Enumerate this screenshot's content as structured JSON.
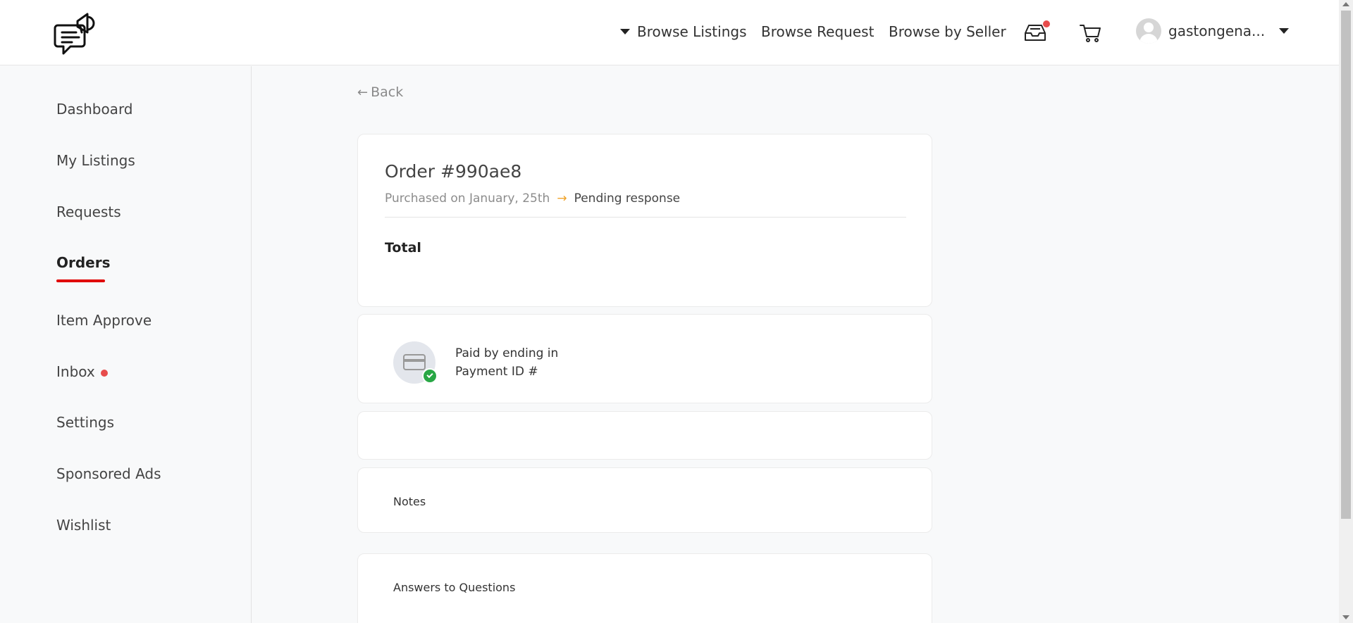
{
  "header": {
    "nav": {
      "browse_listings": "Browse Listings",
      "browse_request": "Browse Request",
      "browse_by_seller": "Browse by Seller"
    },
    "user": {
      "name": "gastongena..."
    },
    "icons": {
      "logo": "chat-megaphone-logo",
      "inbox": "inbox-tray-icon",
      "cart": "shopping-cart-icon",
      "avatar": "user-avatar-icon"
    },
    "colors": {
      "notification_dot": "#e74c4c"
    }
  },
  "sidebar": {
    "items": [
      {
        "label": "Dashboard"
      },
      {
        "label": "My Listings"
      },
      {
        "label": "Requests"
      },
      {
        "label": "Orders",
        "active": true
      },
      {
        "label": "Item Approve"
      },
      {
        "label": "Inbox",
        "has_notification": true
      },
      {
        "label": "Settings"
      },
      {
        "label": "Sponsored Ads"
      },
      {
        "label": "Wishlist"
      }
    ],
    "active_color": "#e00000"
  },
  "main": {
    "back_label": "Back",
    "order": {
      "title": "Order #990ae8",
      "purchased": "Purchased on January, 25th",
      "status": "Pending response",
      "total_label": "Total"
    },
    "payment": {
      "line1": "Paid by ending in",
      "line2": "Payment ID #",
      "status_color": "#28a745"
    },
    "notes_label": "Notes",
    "answers_label": "Answers to Questions"
  }
}
